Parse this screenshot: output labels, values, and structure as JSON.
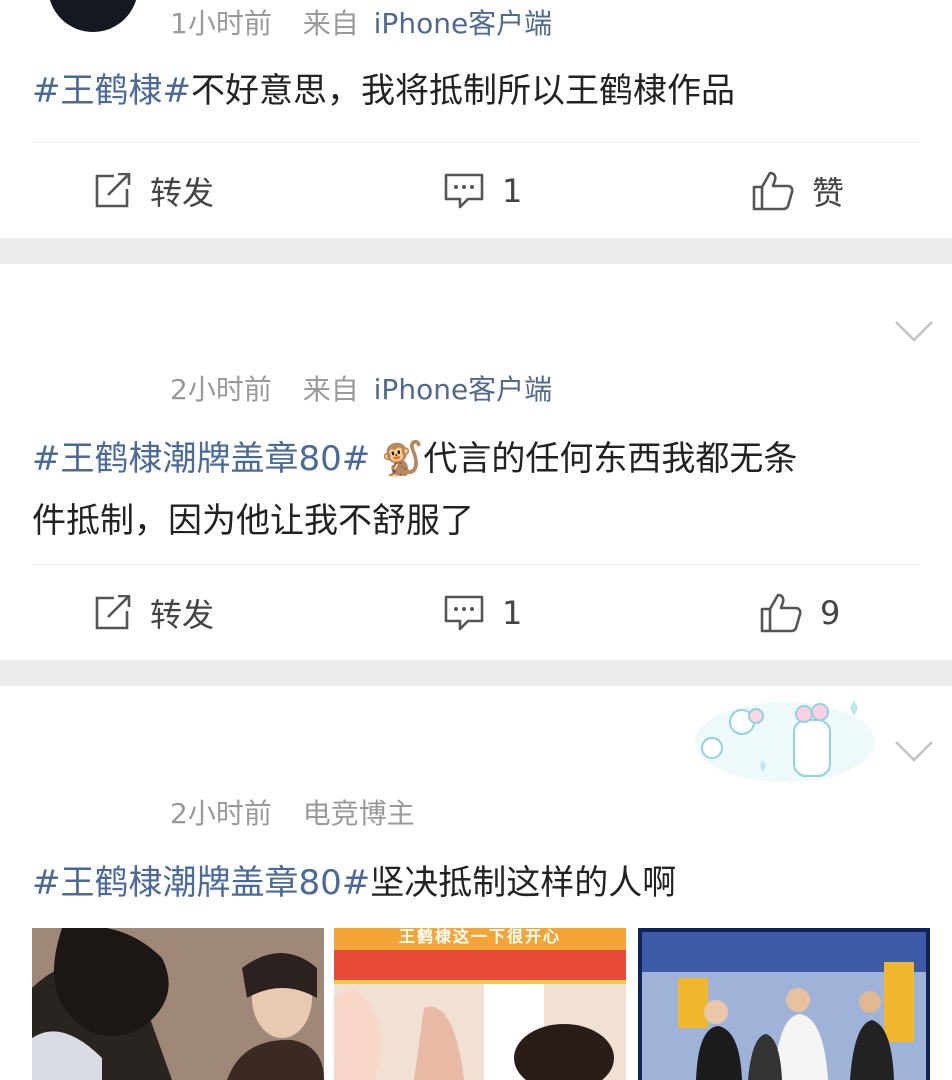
{
  "posts": [
    {
      "time": "1小时前",
      "source_prefix": "来自",
      "source": "iPhone客户端",
      "hashtag": "#王鹤棣#",
      "text": "不好意思，我将抵制所以王鹤棣作品",
      "repost_label": "转发",
      "comment_count": "1",
      "like_label": "赞"
    },
    {
      "time": "2小时前",
      "source_prefix": "来自",
      "source": "iPhone客户端",
      "hashtag": "#王鹤棣潮牌盖章80#",
      "emoji": "🐒",
      "text_line1": "代言的任何东西我都无条",
      "text_line2": "件抵制，因为他让我不舒服了",
      "repost_label": "转发",
      "comment_count": "1",
      "like_count": "9"
    },
    {
      "time": "2小时前",
      "source": "电竞博主",
      "hashtag": "#王鹤棣潮牌盖章80#",
      "text": "坚决抵制这样的人啊",
      "images": [
        {
          "name": "drama-still-thumbnail"
        },
        {
          "name": "variety-show-thumbnail",
          "caption": "王鹤棣这一下很开心"
        },
        {
          "name": "airport-photo-thumbnail"
        }
      ]
    }
  ],
  "colors": {
    "hashtag": "#4a6a9a",
    "source_link": "#506a8f",
    "meta": "#9a9a9a",
    "separator": "#ececec"
  }
}
